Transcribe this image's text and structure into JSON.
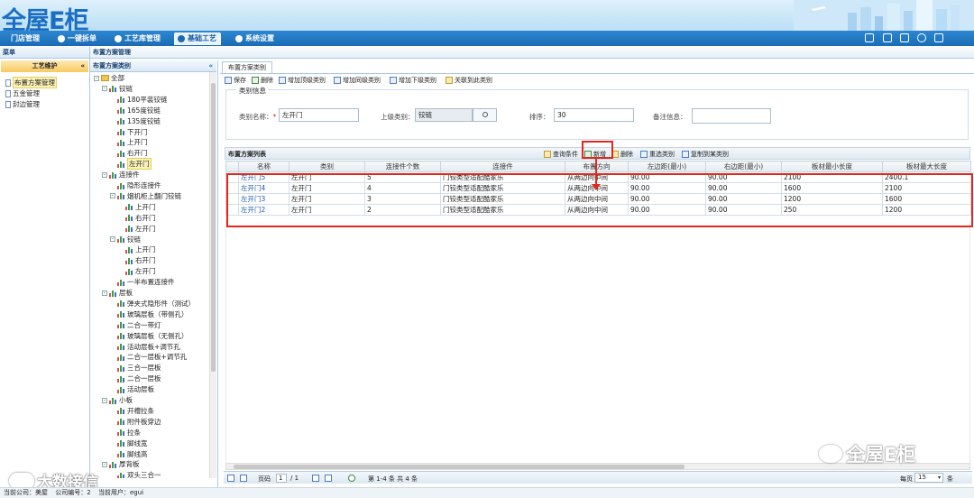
{
  "app": {
    "logo_text": "全屋E柜"
  },
  "nav": {
    "tabs": [
      {
        "label": "门店管理"
      },
      {
        "label": "一键拆单"
      },
      {
        "label": "工艺库管理"
      },
      {
        "label": "基础工艺"
      },
      {
        "label": "系统设置"
      }
    ]
  },
  "menu_panel": {
    "title": "菜单",
    "section": "工艺维护",
    "collapse_glyph": "«"
  },
  "menu_tree": [
    {
      "label": "布置方案管理"
    },
    {
      "label": "五金管理"
    },
    {
      "label": "封边管理"
    }
  ],
  "breadcrumb": {
    "text": "布置方案管理"
  },
  "category_panel": {
    "title": "布置方案类别"
  },
  "category_tree": [
    {
      "label": "全部",
      "level": 0,
      "icon": "folder",
      "toggle": "-"
    },
    {
      "label": "铰链",
      "level": 1,
      "icon": "bar",
      "toggle": "-"
    },
    {
      "label": "180平装铰链",
      "level": 2,
      "icon": "bar"
    },
    {
      "label": "165度铰链",
      "level": 2,
      "icon": "bar"
    },
    {
      "label": "135度铰链",
      "level": 2,
      "icon": "bar"
    },
    {
      "label": "下开门",
      "level": 2,
      "icon": "bar"
    },
    {
      "label": "上开门",
      "level": 2,
      "icon": "bar"
    },
    {
      "label": "右开门",
      "level": 2,
      "icon": "bar"
    },
    {
      "label": "左开门",
      "level": 2,
      "icon": "bar",
      "selected": true
    },
    {
      "label": "连接件",
      "level": 1,
      "icon": "bar",
      "toggle": "-"
    },
    {
      "label": "隐形连接件",
      "level": 2,
      "icon": "bar"
    },
    {
      "label": "烟机柜上翻门铰链",
      "level": 2,
      "icon": "bar",
      "toggle": "-"
    },
    {
      "label": "上开门",
      "level": 3,
      "icon": "bar"
    },
    {
      "label": "右开门",
      "level": 3,
      "icon": "bar"
    },
    {
      "label": "左开门",
      "level": 3,
      "icon": "bar"
    },
    {
      "label": "铰链",
      "level": 2,
      "icon": "bar",
      "toggle": "-"
    },
    {
      "label": "上开门",
      "level": 3,
      "icon": "bar"
    },
    {
      "label": "右开门",
      "level": 3,
      "icon": "bar"
    },
    {
      "label": "左开门",
      "level": 3,
      "icon": "bar"
    },
    {
      "label": "一半布置连接件",
      "level": 2,
      "icon": "bar"
    },
    {
      "label": "层板",
      "level": 1,
      "icon": "bar",
      "toggle": "-"
    },
    {
      "label": "弹夹式隐形件（测试）",
      "level": 2,
      "icon": "bar"
    },
    {
      "label": "玻璃层板（带侧孔）",
      "level": 2,
      "icon": "bar"
    },
    {
      "label": "二合一带灯",
      "level": 2,
      "icon": "bar"
    },
    {
      "label": "玻璃层板（无侧孔）",
      "level": 2,
      "icon": "bar"
    },
    {
      "label": "活动层板+调节孔",
      "level": 2,
      "icon": "bar"
    },
    {
      "label": "二合一层板+调节孔",
      "level": 2,
      "icon": "bar"
    },
    {
      "label": "三合一层板",
      "level": 2,
      "icon": "bar"
    },
    {
      "label": "二合一层板",
      "level": 2,
      "icon": "bar"
    },
    {
      "label": "活动层板",
      "level": 2,
      "icon": "bar"
    },
    {
      "label": "小板",
      "level": 1,
      "icon": "bar",
      "toggle": "-"
    },
    {
      "label": "开槽拉条",
      "level": 2,
      "icon": "bar"
    },
    {
      "label": "附件板穿边",
      "level": 2,
      "icon": "bar"
    },
    {
      "label": "拉条",
      "level": 2,
      "icon": "bar"
    },
    {
      "label": "脚线宽",
      "level": 2,
      "icon": "bar"
    },
    {
      "label": "脚线高",
      "level": 2,
      "icon": "bar"
    },
    {
      "label": "厚背板",
      "level": 1,
      "icon": "bar",
      "toggle": "-"
    },
    {
      "label": "双头三合一",
      "level": 2,
      "icon": "bar"
    }
  ],
  "main_tab": {
    "label": "布置方案类别"
  },
  "toolbar": {
    "buttons": [
      {
        "label": "保存"
      },
      {
        "label": "删除"
      },
      {
        "label": "增加顶级类别"
      },
      {
        "label": "增加同级类别"
      },
      {
        "label": "增加下级类别"
      },
      {
        "label": "关联到此类别"
      }
    ]
  },
  "category_info": {
    "legend": "类别信息",
    "name_label": "类别名称：",
    "required_mark": "*",
    "name_value": "左开门",
    "parent_label": "上级类别：",
    "parent_value": "铰链",
    "sort_label": "排序：",
    "sort_value": "30",
    "remark_label": "备注信息：",
    "remark_value": ""
  },
  "grid": {
    "title": "布置方案列表",
    "actions": [
      {
        "label": "查询条件"
      },
      {
        "label": "新增"
      },
      {
        "label": "删除"
      },
      {
        "label": "重选类别"
      },
      {
        "label": "复制到某类别"
      }
    ],
    "columns": [
      "名称",
      "类别",
      "连接件个数",
      "连接件",
      "布置方向",
      "左边距(最小)",
      "右边距(最小)",
      "板材最小长度",
      "板材最大长度"
    ],
    "rows": [
      [
        "左开门5",
        "左开门",
        "5",
        "门铰类型适配酷家乐",
        "从两边向中间",
        "90.00",
        "90.00",
        "2100",
        "2400.1"
      ],
      [
        "左开门4",
        "左开门",
        "4",
        "门铰类型适配酷家乐",
        "从两边向中间",
        "90.00",
        "90.00",
        "1600",
        "2100"
      ],
      [
        "左开门3",
        "左开门",
        "3",
        "门铰类型适配酷家乐",
        "从两边向中间",
        "90.00",
        "90.00",
        "1200",
        "1600"
      ],
      [
        "左开门2",
        "左开门",
        "2",
        "门铰类型适配酷家乐",
        "从两边向中间",
        "90.00",
        "90.00",
        "250",
        "1200"
      ]
    ]
  },
  "pager": {
    "page_label": "页码",
    "page_value": "1",
    "total_pages": "/ 1",
    "summary": "第 1-4 条  共 4 条",
    "per_page_label": "每页",
    "per_page_value": "15",
    "per_page_unit": "条"
  },
  "watermark": {
    "text": "全屋E柜"
  },
  "watermark2": {
    "text": "大数接信"
  },
  "status_bar": {
    "company_label": "当前公司：",
    "company_value": "美屋",
    "company_no_label": "公司编号：",
    "company_no_value": "2",
    "user_label": "当前用户：",
    "user_value": "egui"
  },
  "colors": {
    "accent": "#1a6bb5",
    "highlight": "#e0281c",
    "selected": "#fbf2b8"
  }
}
